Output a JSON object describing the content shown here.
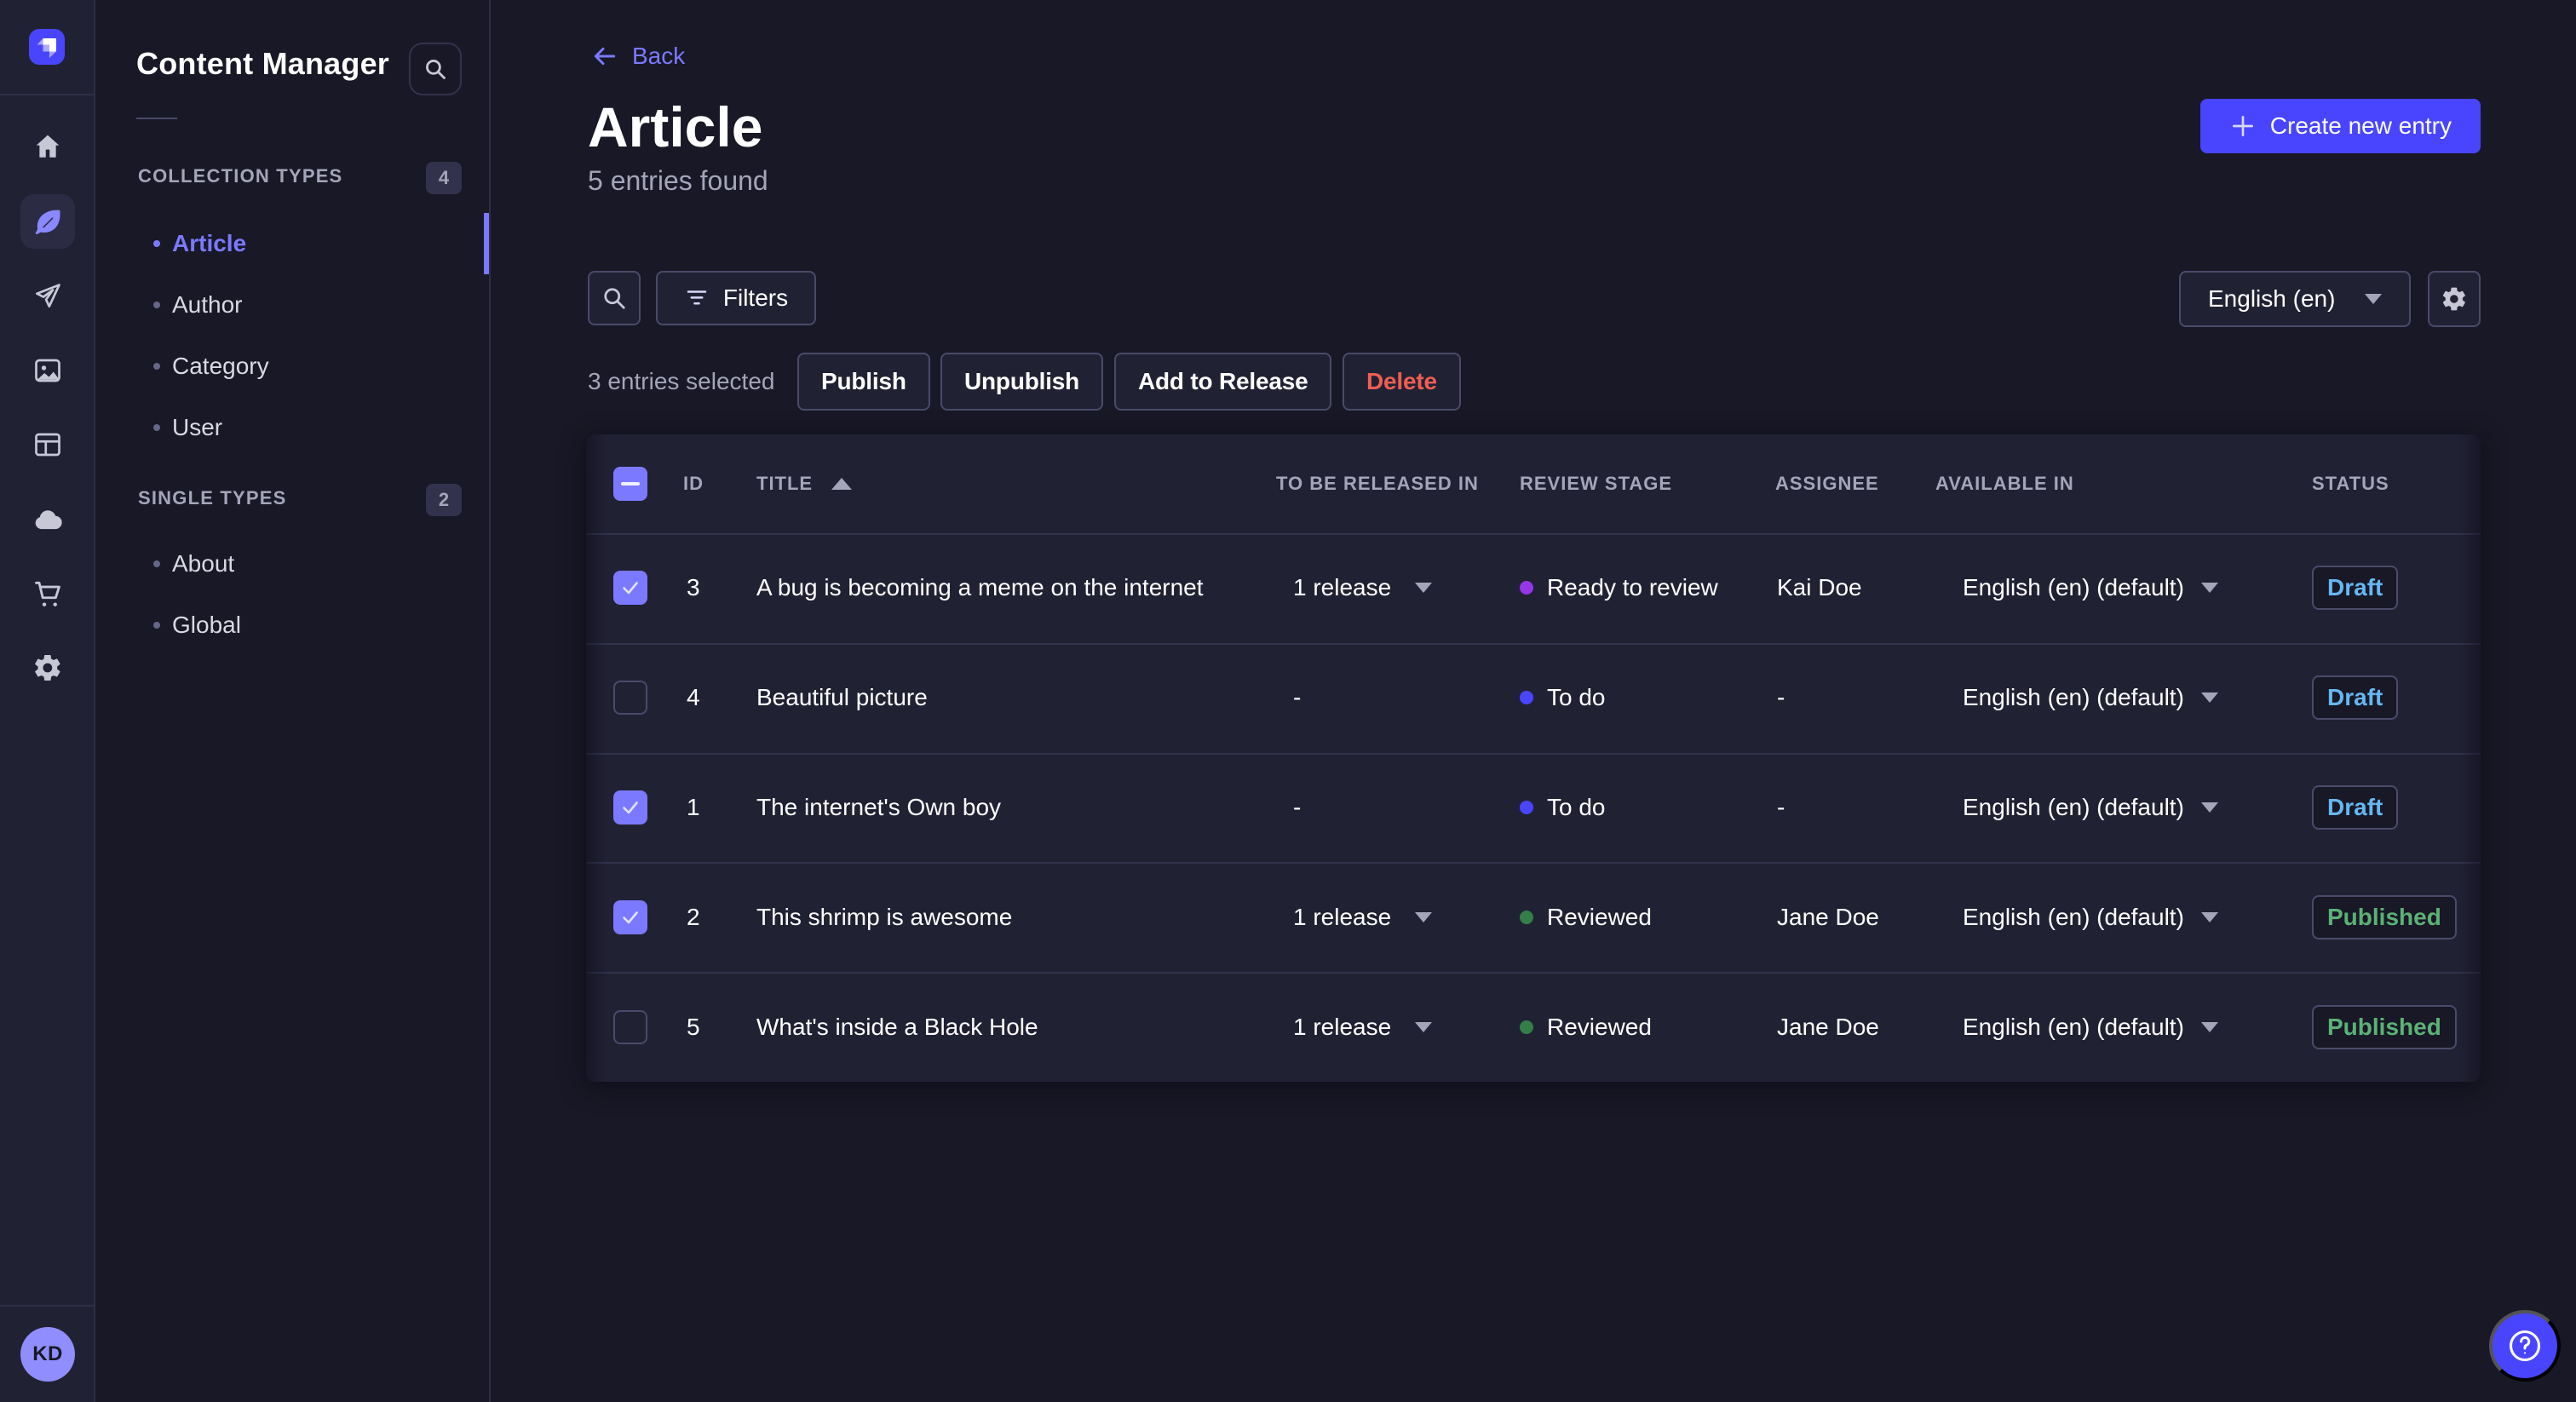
{
  "colors": {
    "primary": "#4945ff",
    "link": "#7b79ff",
    "background": "#181826",
    "panel": "#212134",
    "border": "#4a4a6a",
    "divider": "#32324d",
    "text": "#ffffff",
    "muted": "#a5a5ba",
    "draft": "#66b7f1",
    "published": "#5cb176",
    "danger": "#ee5e52"
  },
  "rail": {
    "logo": "strapi-logo",
    "items": [
      {
        "icon": "home"
      },
      {
        "icon": "content-manager",
        "active": true
      },
      {
        "icon": "send"
      },
      {
        "icon": "media-library"
      },
      {
        "icon": "content-type-builder"
      },
      {
        "icon": "cloud"
      },
      {
        "icon": "marketplace"
      },
      {
        "icon": "settings"
      }
    ],
    "avatar_initials": "KD"
  },
  "subnav": {
    "title": "Content Manager",
    "sections": [
      {
        "label": "COLLECTION TYPES",
        "count": "4",
        "items": [
          {
            "label": "Article",
            "active": true
          },
          {
            "label": "Author"
          },
          {
            "label": "Category"
          },
          {
            "label": "User"
          }
        ]
      },
      {
        "label": "SINGLE TYPES",
        "count": "2",
        "items": [
          {
            "label": "About"
          },
          {
            "label": "Global"
          }
        ]
      }
    ]
  },
  "header": {
    "back": "Back",
    "title": "Article",
    "subtitle": "5 entries found",
    "create_label": "Create new entry"
  },
  "toolbar": {
    "filters_label": "Filters",
    "selected_text": "3 entries selected",
    "publish_label": "Publish",
    "unpublish_label": "Unpublish",
    "add_to_release_label": "Add to Release",
    "delete_label": "Delete",
    "locale_value": "English (en)"
  },
  "table": {
    "columns": {
      "id": "ID",
      "title": "TITLE",
      "release": "TO BE RELEASED IN",
      "stage": "REVIEW STAGE",
      "assignee": "ASSIGNEE",
      "available": "AVAILABLE IN",
      "status": "STATUS"
    },
    "sorted_by": "TITLE",
    "sort_direction": "ascending",
    "rows": [
      {
        "selected": true,
        "id": "3",
        "title": "A bug is becoming a meme on the internet",
        "release": "1 release",
        "stage": "Ready to review",
        "stage_color": "#9736e8",
        "assignee": "Kai Doe",
        "locale": "English (en) (default)",
        "status": "Draft"
      },
      {
        "selected": false,
        "id": "4",
        "title": "Beautiful picture",
        "release": "-",
        "stage": "To do",
        "stage_color": "#4945ff",
        "assignee": "-",
        "locale": "English (en) (default)",
        "status": "Draft"
      },
      {
        "selected": true,
        "id": "1",
        "title": "The internet's Own boy",
        "release": "-",
        "stage": "To do",
        "stage_color": "#4945ff",
        "assignee": "-",
        "locale": "English (en) (default)",
        "status": "Draft"
      },
      {
        "selected": true,
        "id": "2",
        "title": "This shrimp is awesome",
        "release": "1 release",
        "stage": "Reviewed",
        "stage_color": "#328048",
        "assignee": "Jane Doe",
        "locale": "English (en) (default)",
        "status": "Published"
      },
      {
        "selected": false,
        "id": "5",
        "title": "What's inside a Black Hole",
        "release": "1 release",
        "stage": "Reviewed",
        "stage_color": "#328048",
        "assignee": "Jane Doe",
        "locale": "English (en) (default)",
        "status": "Published"
      }
    ]
  },
  "help": {
    "label": "help"
  }
}
